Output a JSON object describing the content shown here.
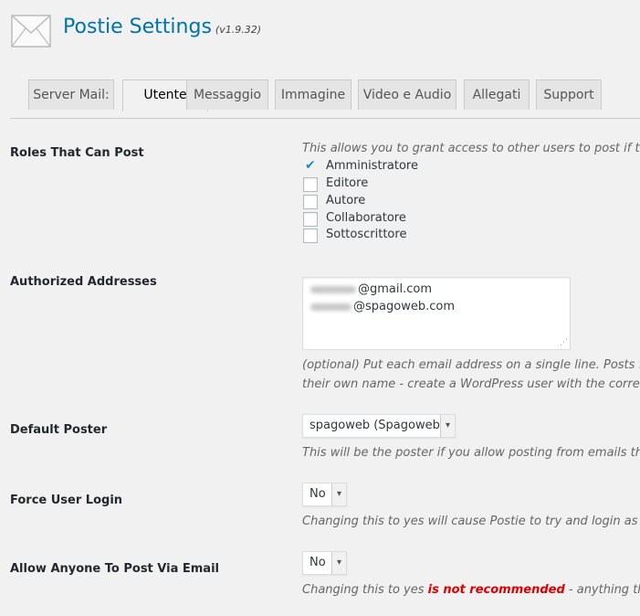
{
  "header": {
    "title": "Postie Settings",
    "version": "(v1.9.32)",
    "icon": "envelope-icon"
  },
  "tabs": [
    {
      "label": "Server Mail:",
      "active": false
    },
    {
      "label": "Utente",
      "active": true
    },
    {
      "label": "Messaggio",
      "active": false
    },
    {
      "label": "Immagine",
      "active": false
    },
    {
      "label": "Video e Audio",
      "active": false
    },
    {
      "label": "Allegati",
      "active": false
    },
    {
      "label": "Support",
      "active": false
    }
  ],
  "roles": {
    "label": "Roles That Can Post",
    "description": "This allows you to grant access to other users to post if they",
    "options": [
      {
        "label": "Amministratore",
        "checked": true
      },
      {
        "label": "Editore",
        "checked": false
      },
      {
        "label": "Autore",
        "checked": false
      },
      {
        "label": "Collaboratore",
        "checked": false
      },
      {
        "label": "Sottoscrittore",
        "checked": false
      }
    ]
  },
  "authorized": {
    "label": "Authorized Addresses",
    "addresses": [
      "@gmail.com",
      "@spagoweb.com"
    ],
    "help_line1": "(optional) Put each email address on a single line. Posts fro",
    "help_line2": "their own name - create a WordPress user with the correct a"
  },
  "default_poster": {
    "label": "Default Poster",
    "value": "spagoweb (Spagoweb)",
    "description": "This will be the poster if you allow posting from emails tha"
  },
  "force_login": {
    "label": "Force User Login",
    "value": "No",
    "description": "Changing this to yes will cause Postie to try and login as th"
  },
  "allow_anyone": {
    "label": "Allow Anyone To Post Via Email",
    "value": "No",
    "desc_prefix": "Changing this to yes ",
    "desc_warning": "is not recommended",
    "desc_suffix": " - anything that g",
    "warning_color": "#dd0000"
  }
}
